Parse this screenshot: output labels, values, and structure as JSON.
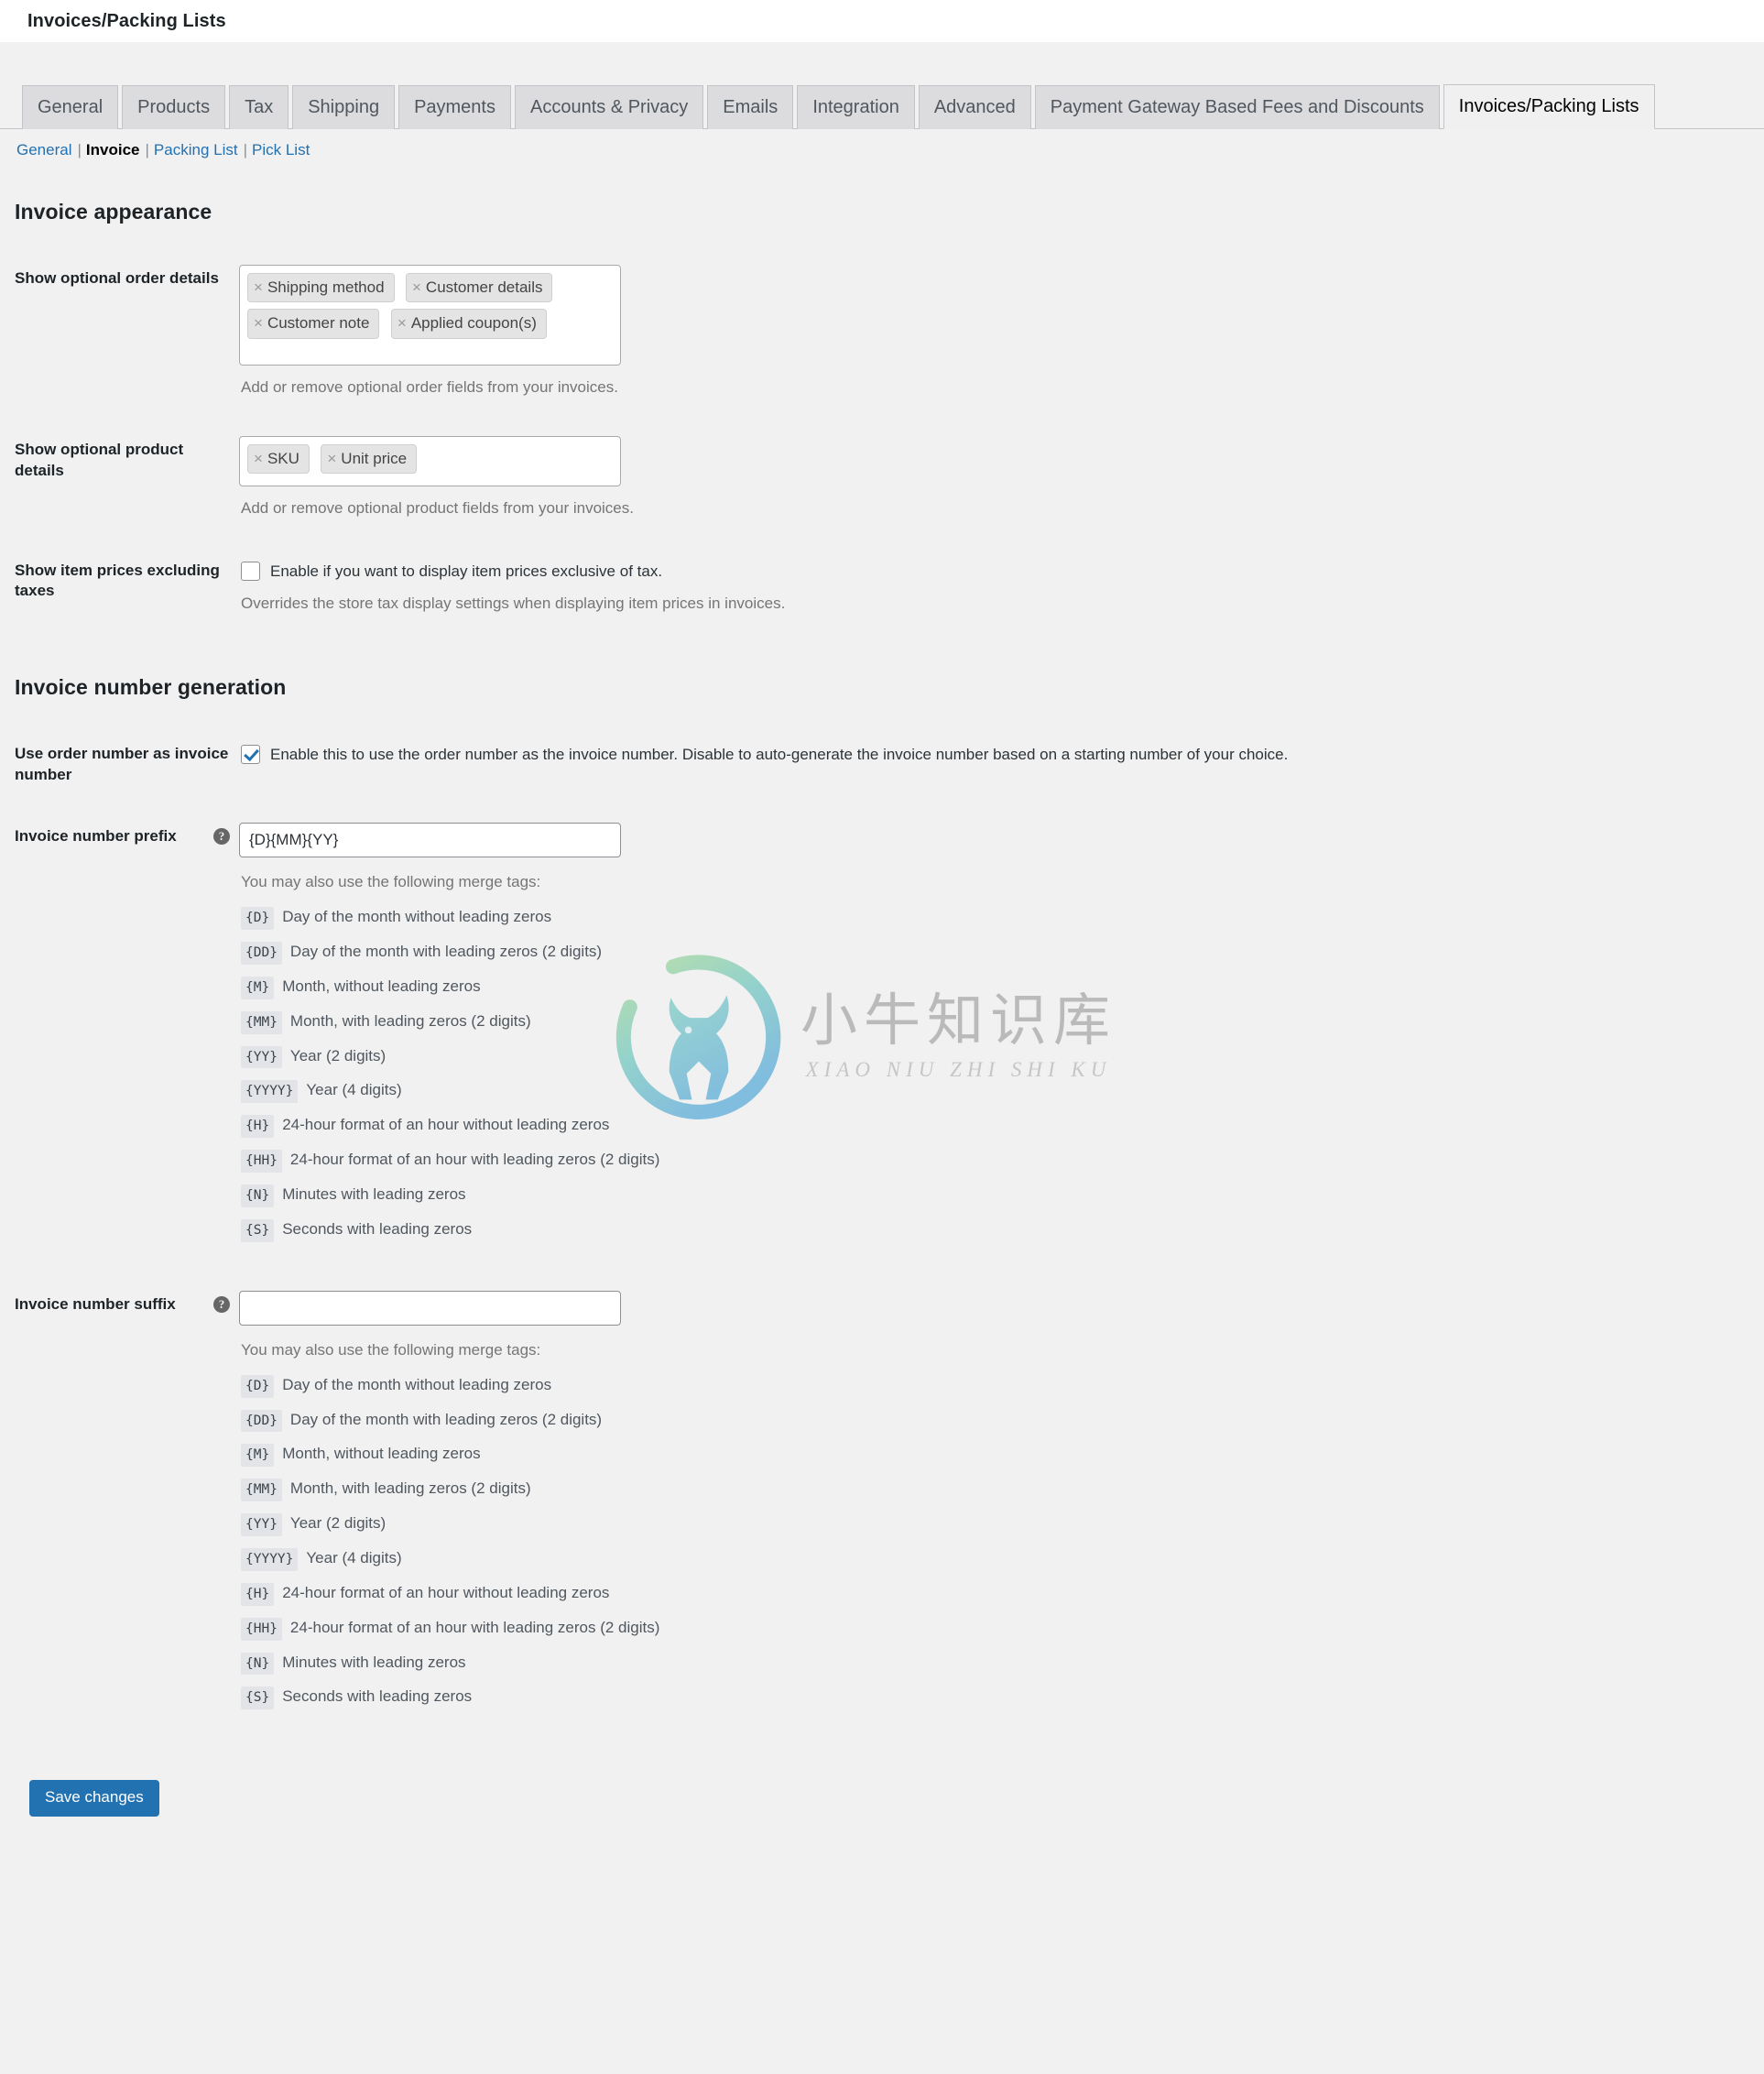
{
  "header": {
    "title": "Invoices/Packing Lists"
  },
  "nav_tabs": [
    {
      "label": "General",
      "active": false
    },
    {
      "label": "Products",
      "active": false
    },
    {
      "label": "Tax",
      "active": false
    },
    {
      "label": "Shipping",
      "active": false
    },
    {
      "label": "Payments",
      "active": false
    },
    {
      "label": "Accounts & Privacy",
      "active": false
    },
    {
      "label": "Emails",
      "active": false
    },
    {
      "label": "Integration",
      "active": false
    },
    {
      "label": "Advanced",
      "active": false
    },
    {
      "label": "Payment Gateway Based Fees and Discounts",
      "active": false
    },
    {
      "label": "Invoices/Packing Lists",
      "active": true
    }
  ],
  "sub_nav": [
    {
      "label": "General",
      "current": false
    },
    {
      "label": "Invoice",
      "current": true
    },
    {
      "label": "Packing List",
      "current": false
    },
    {
      "label": "Pick List",
      "current": false
    }
  ],
  "sections": {
    "appearance": {
      "title": "Invoice appearance",
      "order_details": {
        "label": "Show optional order details",
        "chips": [
          "Shipping method",
          "Customer details",
          "Customer note",
          "Applied coupon(s)"
        ],
        "description": "Add or remove optional order fields from your invoices."
      },
      "product_details": {
        "label": "Show optional product details",
        "chips": [
          "SKU",
          "Unit price"
        ],
        "description": "Add or remove optional product fields from your invoices."
      },
      "prices_excl_tax": {
        "label": "Show item prices excluding taxes",
        "checkbox_label": "Enable if you want to display item prices exclusive of tax.",
        "checked": false,
        "description": "Overrides the store tax display settings when displaying item prices in invoices."
      }
    },
    "numbering": {
      "title": "Invoice number generation",
      "use_order_number": {
        "label": "Use order number as invoice number",
        "checkbox_label": "Enable this to use the order number as the invoice number. Disable to auto-generate the invoice number based on a starting number of your choice.",
        "checked": true
      },
      "prefix": {
        "label": "Invoice number prefix",
        "value": "{D}{MM}{YY}",
        "merge_intro": "You may also use the following merge tags:"
      },
      "suffix": {
        "label": "Invoice number suffix",
        "value": "",
        "merge_intro": "You may also use the following merge tags:"
      }
    }
  },
  "merge_tags": [
    {
      "tag": "{D}",
      "desc": "Day of the month without leading zeros"
    },
    {
      "tag": "{DD}",
      "desc": "Day of the month with leading zeros (2 digits)"
    },
    {
      "tag": "{M}",
      "desc": "Month, without leading zeros"
    },
    {
      "tag": "{MM}",
      "desc": "Month, with leading zeros (2 digits)"
    },
    {
      "tag": "{YY}",
      "desc": "Year (2 digits)"
    },
    {
      "tag": "{YYYY}",
      "desc": "Year (4 digits)"
    },
    {
      "tag": "{H}",
      "desc": "24-hour format of an hour without leading zeros"
    },
    {
      "tag": "{HH}",
      "desc": "24-hour format of an hour with leading zeros (2 digits)"
    },
    {
      "tag": "{N}",
      "desc": "Minutes with leading zeros"
    },
    {
      "tag": "{S}",
      "desc": "Seconds with leading zeros"
    }
  ],
  "submit": {
    "label": "Save changes"
  },
  "watermark": {
    "chinese": "小牛知识库",
    "pinyin": "XIAO NIU ZHI SHI KU"
  },
  "help_icon": "?",
  "colors": {
    "accent": "#2271b1",
    "tab_inactive_bg": "#dcdcde",
    "page_bg": "#f1f1f1",
    "chip_bg": "#e4e4e4",
    "muted_text": "#757575"
  }
}
